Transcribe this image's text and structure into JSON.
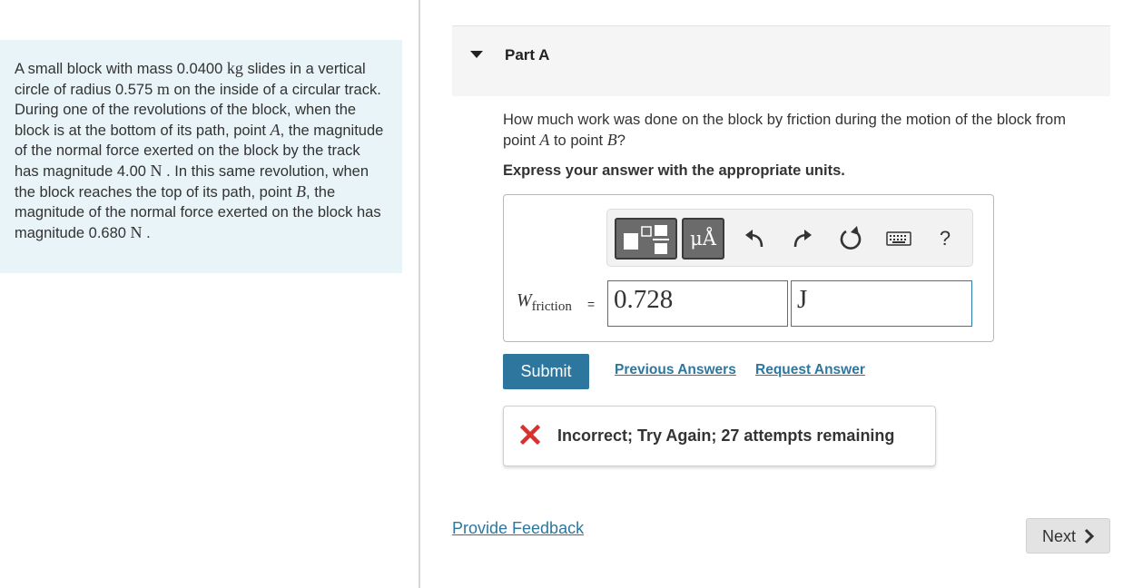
{
  "problem": {
    "t1": "A small block with mass 0.0400",
    "m1": "kg",
    "t2": "slides in a vertical circle of radius 0.575",
    "m2": "m",
    "t3": "on the inside of a circular track. During one of the revolutions of the block, when the block is at the bottom of its path, point",
    "m3": "A",
    "t4": ", the magnitude of the normal force exerted on the block by the track has magnitude 4.00",
    "m4": "N",
    "t5": ". In this same revolution, when the block reaches the top of its path, point",
    "m5": "B",
    "t6": ", the magnitude of the normal force exerted on the block has magnitude 0.680",
    "m6": "N",
    "t7": "."
  },
  "part": {
    "title": "Part A"
  },
  "question": {
    "t1": "How much work was done on the block by friction during the motion of the block from point",
    "m1": "A",
    "t2": "to point",
    "m2": "B",
    "t3": "?"
  },
  "instructions": "Express your answer with the appropriate units.",
  "toolbar": {
    "units_label": "μÅ",
    "help_label": "?"
  },
  "answer": {
    "variable": "W",
    "subscript": "friction",
    "equals": "=",
    "value": "0.728",
    "unit": "J"
  },
  "actions": {
    "submit_label": "Submit",
    "previous_answers": "Previous Answers",
    "request_answer": "Request Answer"
  },
  "feedback": {
    "message": "Incorrect; Try Again; 27 attempts remaining",
    "status_color": "#d6322e"
  },
  "footer": {
    "provide_feedback": "Provide Feedback",
    "next_label": "Next"
  },
  "colors": {
    "accent": "#2d779f",
    "problem_bg": "#e8f4f7"
  }
}
